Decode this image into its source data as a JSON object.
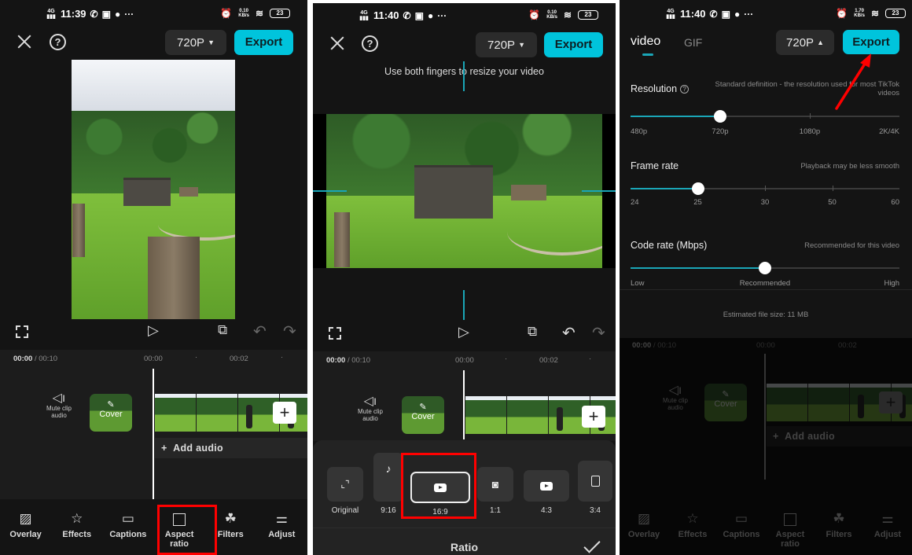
{
  "panels": [
    {
      "status": {
        "network": "4G",
        "time": "11:39",
        "speed_top": "0.10",
        "speed_unit": "KB/s",
        "battery": "23"
      },
      "header": {
        "resolution": "720P",
        "export": "Export"
      },
      "timeline": {
        "current": "00:00",
        "total": "/ 00:10",
        "tick_1": "00:00",
        "tick_2": "00:02",
        "mute_label": "Mute clip audio",
        "cover_label": "Cover",
        "add_audio": "Add audio"
      },
      "toolbar": [
        {
          "label": "Overlay",
          "icon": "overlay-icon"
        },
        {
          "label": "Effects",
          "icon": "effects-icon"
        },
        {
          "label": "Captions",
          "icon": "captions-icon"
        },
        {
          "label": "Aspect ratio",
          "icon": "aspect-ratio-icon",
          "highlighted": true
        },
        {
          "label": "Filters",
          "icon": "filters-icon"
        },
        {
          "label": "Adjust",
          "icon": "adjust-icon"
        }
      ]
    },
    {
      "status": {
        "network": "4G",
        "time": "11:40",
        "speed_top": "0.10",
        "speed_unit": "KB/s",
        "battery": "23"
      },
      "header": {
        "resolution": "720P",
        "export": "Export"
      },
      "hint": "Use both fingers to resize your video",
      "timeline": {
        "current": "00:00",
        "total": "/ 00:10",
        "tick_1": "00:00",
        "tick_2": "00:02",
        "mute_label": "Mute clip audio",
        "cover_label": "Cover"
      },
      "ratio": {
        "title": "Ratio",
        "options": [
          {
            "label": "Original",
            "icon": "expand-icon"
          },
          {
            "label": "9:16",
            "icon": "tiktok-icon"
          },
          {
            "label": "16:9",
            "icon": "youtube-icon",
            "selected": true
          },
          {
            "label": "1:1",
            "icon": "instagram-icon"
          },
          {
            "label": "4:3",
            "icon": "youtube-icon"
          },
          {
            "label": "3:4",
            "icon": "portrait-icon"
          }
        ]
      }
    },
    {
      "status": {
        "network": "4G",
        "time": "11:40",
        "speed_top": "1.70",
        "speed_unit": "KB/s",
        "battery": "23"
      },
      "tabs": {
        "video": "video",
        "gif": "GIF"
      },
      "header": {
        "resolution": "720P",
        "export": "Export"
      },
      "resolution": {
        "title": "Resolution",
        "desc": "Standard definition - the resolution used for most TikTok videos",
        "labels": [
          "480p",
          "720p",
          "1080p",
          "2K/4K"
        ],
        "selected": "720p",
        "fraction": 0.333
      },
      "frame_rate": {
        "title": "Frame rate",
        "desc": "Playback may be less smooth",
        "labels": [
          "24",
          "25",
          "30",
          "50",
          "60"
        ],
        "selected": "25",
        "fraction": 0.25
      },
      "code_rate": {
        "title": "Code rate (Mbps)",
        "desc": "Recommended for this video",
        "labels": [
          "Low",
          "Recommended",
          "High"
        ],
        "selected": "Recommended",
        "fraction": 0.5
      },
      "file_size": "Estimated file size: 11 MB",
      "timeline": {
        "current": "00:00",
        "total": "/ 00:10",
        "tick_1": "00:00",
        "tick_2": "00:02",
        "mute_label": "Mute clip audio",
        "cover_label": "Cover",
        "add_audio": "Add audio"
      },
      "toolbar": [
        {
          "label": "Overlay"
        },
        {
          "label": "Effects"
        },
        {
          "label": "Captions"
        },
        {
          "label": "Aspect ratio"
        },
        {
          "label": "Filters"
        },
        {
          "label": "Adjust"
        }
      ]
    }
  ],
  "colors": {
    "accent": "#00c4dc",
    "highlight": "#ff0000",
    "background": "#141414"
  }
}
